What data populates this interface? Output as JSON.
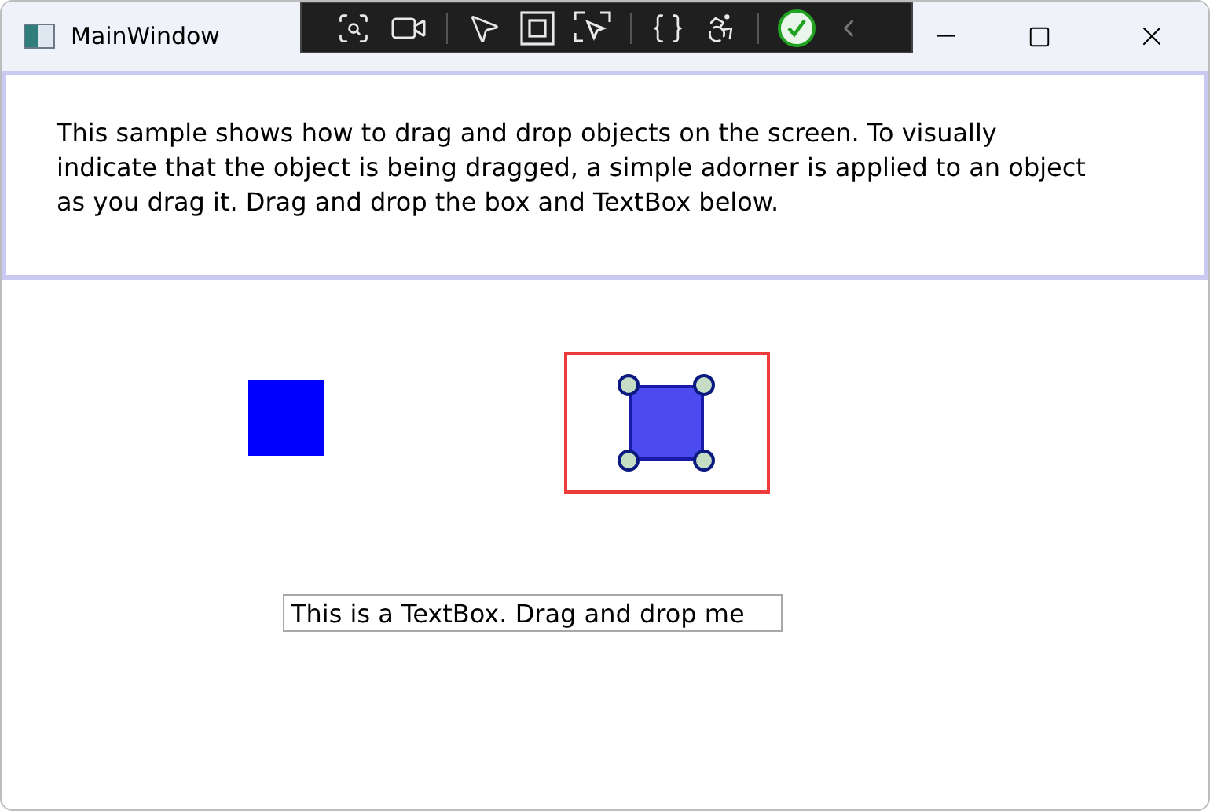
{
  "window": {
    "title": "MainWindow"
  },
  "description": "This sample shows how to drag and drop objects on the screen. To visually indicate that the object is being dragged, a simple adorner is applied to an object as you drag it. Drag and drop the box and TextBox below.",
  "canvas": {
    "boxes": [
      {
        "adorned": false
      },
      {
        "adorned": true
      }
    ],
    "textbox": {
      "value": "This is a TextBox. Drag and drop me"
    }
  }
}
